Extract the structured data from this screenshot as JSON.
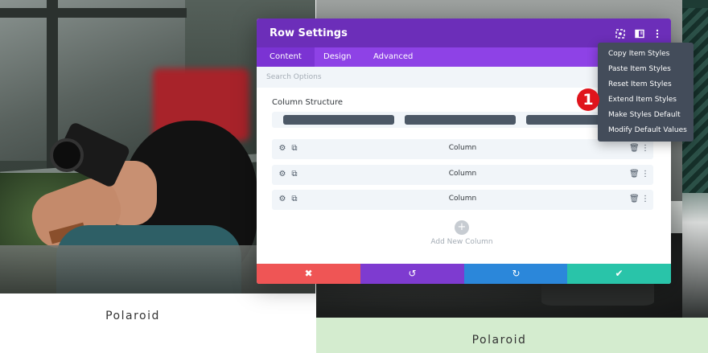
{
  "background": {
    "left_card": {
      "caption": "Polaroid"
    },
    "right_card": {
      "caption": "Polaroid",
      "strip_color": "#d4eccf"
    }
  },
  "modal": {
    "title": "Row Settings",
    "header_icons": [
      "target-icon",
      "split-view-icon",
      "more-vertical-icon"
    ],
    "tabs": [
      {
        "label": "Content",
        "active": true
      },
      {
        "label": "Design",
        "active": false
      },
      {
        "label": "Advanced",
        "active": false
      }
    ],
    "search": {
      "placeholder": "Search Options"
    },
    "column_structure": {
      "label": "Column Structure",
      "columns": 3
    },
    "columns": [
      {
        "label": "Column"
      },
      {
        "label": "Column"
      },
      {
        "label": "Column"
      }
    ],
    "add_column": {
      "icon": "+",
      "label": "Add New Column"
    },
    "footer": {
      "cancel": {
        "icon": "✖",
        "color": "#ef5555"
      },
      "undo": {
        "icon": "↺",
        "color": "#7e3bd0"
      },
      "redo": {
        "icon": "↻",
        "color": "#2b87da"
      },
      "save": {
        "icon": "✔",
        "color": "#29c4a9"
      }
    },
    "colors": {
      "header": "#6c2eb9",
      "tabs": "#8e42e6",
      "active_tab": "#7b33d3"
    }
  },
  "context_menu": {
    "items": [
      {
        "label": "Copy Item Styles"
      },
      {
        "label": "Paste Item Styles"
      },
      {
        "label": "Reset Item Styles"
      },
      {
        "label": "Extend Item Styles"
      },
      {
        "label": "Make Styles Default"
      },
      {
        "label": "Modify Default Values"
      }
    ]
  },
  "annotation": {
    "badge": "1",
    "color": "#e0141c"
  }
}
